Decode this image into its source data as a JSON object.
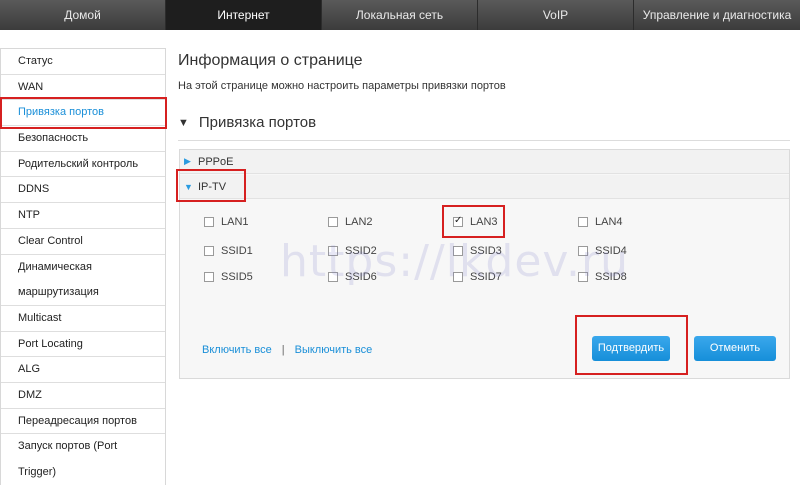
{
  "nav": {
    "tabs": [
      "Домой",
      "Интернет",
      "Локальная сеть",
      "VoIP",
      "Управление и диагностика"
    ],
    "active_index": 1
  },
  "sidebar": {
    "items": [
      "Статус",
      "WAN",
      "Привязка портов",
      "Безопасность",
      "Родительский контроль",
      "DDNS",
      "NTP",
      "Clear Control",
      "Динамическая",
      "маршрутизация",
      "Multicast",
      "Port Locating",
      "ALG",
      "DMZ",
      "Переадресация портов",
      "Запуск портов (Port",
      "Trigger)"
    ],
    "active_index": 2
  },
  "main": {
    "title": "Информация о странице",
    "description": "На этой странице можно настроить параметры привязки портов",
    "section_title": "Привязка портов",
    "rows": [
      {
        "label": "PPPoE",
        "expanded": false
      },
      {
        "label": "IP-TV",
        "expanded": true
      }
    ],
    "ports": [
      {
        "label": "LAN1",
        "checked": false
      },
      {
        "label": "LAN2",
        "checked": false
      },
      {
        "label": "LAN3",
        "checked": true
      },
      {
        "label": "LAN4",
        "checked": false
      },
      {
        "label": "SSID1",
        "checked": false
      },
      {
        "label": "SSID2",
        "checked": false
      },
      {
        "label": "SSID3",
        "checked": false
      },
      {
        "label": "SSID4",
        "checked": false
      },
      {
        "label": "SSID5",
        "checked": false
      },
      {
        "label": "SSID6",
        "checked": false
      },
      {
        "label": "SSID7",
        "checked": false
      },
      {
        "label": "SSID8",
        "checked": false
      }
    ],
    "select_all": "Включить все",
    "separator": "|",
    "deselect_all": "Выключить все",
    "confirm": "Подтвердить",
    "cancel": "Отменить"
  },
  "watermark": "https://lkdev.ru",
  "colors": {
    "accent": "#1a8fd8",
    "highlight": "#d62020",
    "nav_bg": "#4a4a4a",
    "nav_active": "#1e1e1e"
  }
}
